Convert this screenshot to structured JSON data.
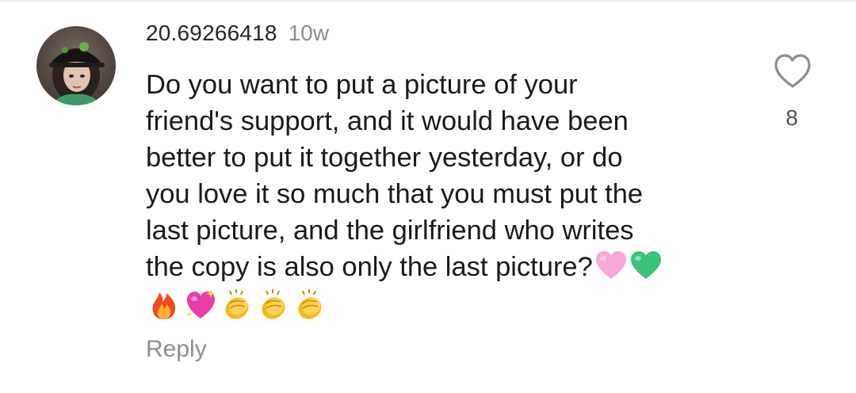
{
  "comment": {
    "username": "20.69266418",
    "timestamp": "10w",
    "text_lines": [
      "Do you want to put a picture of your",
      "friend's support, and it would have been",
      "better to put it together yesterday, or do",
      "you love it so much that you must put the",
      "last picture, and the girlfriend who writes",
      "the copy is also only the last picture?"
    ],
    "inline_emojis": [
      "pink-heart",
      "green-heart"
    ],
    "emoji_row": [
      "fire",
      "sparkling-heart",
      "clapping-hands",
      "clapping-hands",
      "clapping-hands"
    ],
    "reply_label": "Reply",
    "like_count": "8"
  },
  "colors": {
    "username": "#262626",
    "meta": "#8e8e8e",
    "body": "#1a1a1a",
    "heart_outline": "#8e8e8e"
  },
  "icons": {
    "like": "heart-outline-icon",
    "avatar": "profile-avatar"
  }
}
